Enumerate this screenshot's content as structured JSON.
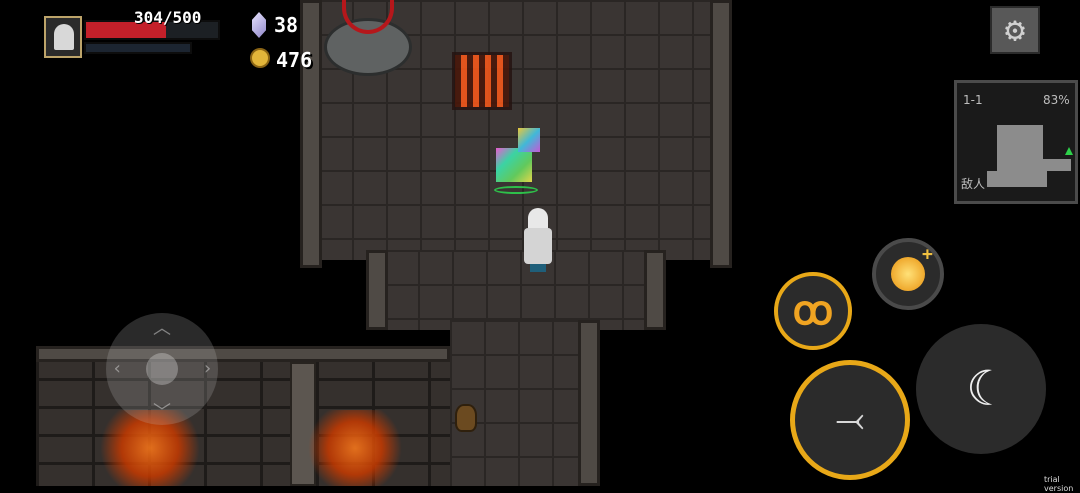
{
  "hud": {
    "hp_text": "304/500",
    "hp_fraction": 0.608,
    "gems": "38",
    "coins": "476"
  },
  "minimap": {
    "level": "1-1",
    "percent": "83%",
    "enemy_label": "敌人"
  },
  "watermark": "trial version",
  "colors": {
    "hp": "#c4202a",
    "gold_ring": "#e8a818",
    "lava": "#ff7a1a"
  },
  "icons": {
    "settings": "gear-icon",
    "gem": "gem-icon",
    "coin": "coin-icon",
    "attack": "crossbow-icon",
    "skill": "fire-swirl-icon",
    "special": "flame-ball-icon",
    "dodge": "crescent-icon"
  }
}
